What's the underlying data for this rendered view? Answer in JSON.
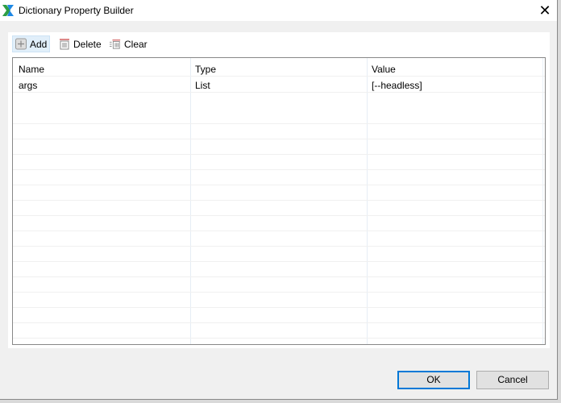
{
  "window": {
    "title": "Dictionary Property Builder",
    "close_label": "✕"
  },
  "toolbar": {
    "add": "Add",
    "delete": "Delete",
    "clear": "Clear"
  },
  "table": {
    "columns": [
      "Name",
      "Type",
      "Value"
    ],
    "rows": [
      [
        "args",
        "List",
        "[--headless]"
      ]
    ]
  },
  "buttons": {
    "ok": "OK",
    "cancel": "Cancel"
  }
}
